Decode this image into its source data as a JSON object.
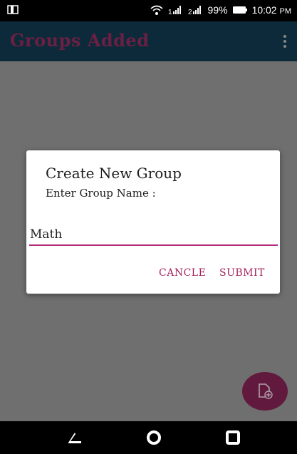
{
  "status_bar": {
    "battery": "99%",
    "time": "10:02",
    "ampm": "PM"
  },
  "app_bar": {
    "title": "Groups Added"
  },
  "dialog": {
    "title": "Create New Group",
    "subtitle": "Enter Group Name :",
    "input_value": "Math",
    "cancel_label": "CANCLE",
    "submit_label": "SUBMIT"
  },
  "colors": {
    "app_bar": "#0d2a3b",
    "title_text": "#6b1f43",
    "accent": "#b32a7a",
    "button_text": "#a3225f",
    "fab": "#611a3d",
    "scrim": "#6f6f6f"
  },
  "icons": {
    "status_left": "cast-icon",
    "wifi": "wifi-icon",
    "signal1": "signal-icon",
    "signal2": "signal-icon",
    "battery": "battery-icon",
    "menu": "overflow-menu-icon",
    "fab": "add-file-icon",
    "back": "back-icon",
    "home": "home-icon",
    "recents": "recents-icon"
  }
}
